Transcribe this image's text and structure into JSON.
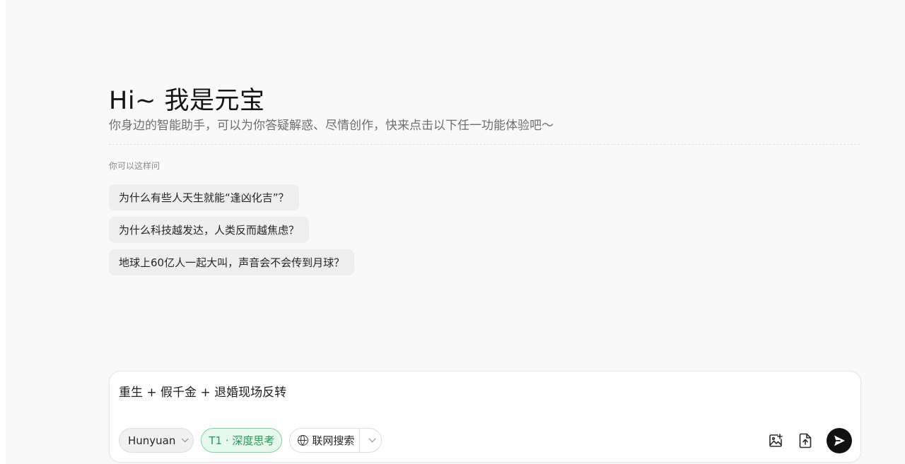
{
  "hero": {
    "greeting": "Hi~ 我是元宝",
    "subtitle": "你身边的智能助手，可以为你答疑解惑、尽情创作，快来点击以下任一功能体验吧～"
  },
  "suggestions": {
    "label": "你可以这样问",
    "items": [
      "为什么有些人天生就能“逢凶化吉”？",
      "为什么科技越发达，人类反而越焦虑？",
      "地球上60亿人一起大叫，声音会不会传到月球？"
    ]
  },
  "composer": {
    "input_value": "重生 + 假千金 + 退婚现场反转",
    "model_label": "Hunyuan",
    "think_label": "T1 · 深度思考",
    "search_label": "联网搜索"
  },
  "colors": {
    "think_accent": "#1e9e4d",
    "send_button": "#111111"
  },
  "icons": {
    "model_dropdown": "chevron-down-icon",
    "search": "globe-icon",
    "search_dropdown": "chevron-down-icon",
    "image": "image-plus-icon",
    "upload": "upload-icon",
    "send": "send-icon"
  }
}
